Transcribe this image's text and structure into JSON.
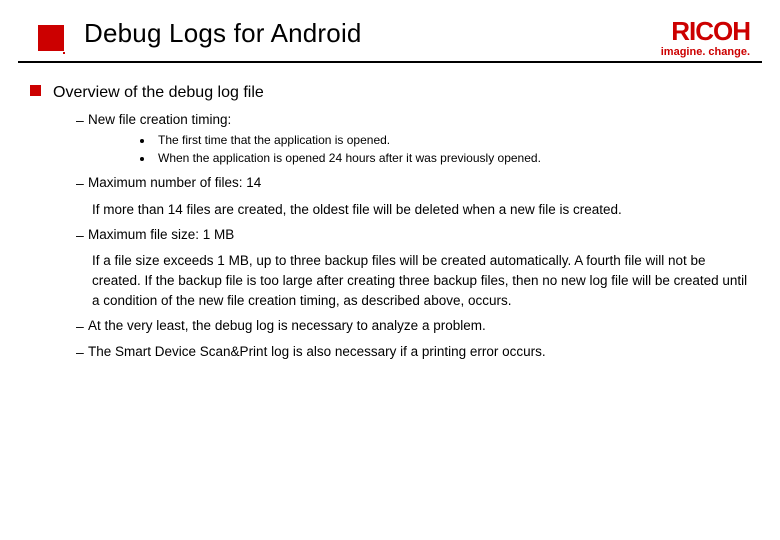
{
  "brand": {
    "name": "RICOH",
    "tagline": "imagine. change."
  },
  "title": "Debug Logs for Android",
  "section": {
    "heading": "Overview of the debug log file",
    "items": {
      "timing": {
        "label": "New file creation timing:",
        "bullets": {
          "b1": "The first time that the application is opened.",
          "b2": "When the application is opened 24 hours after it was previously opened."
        }
      },
      "maxfiles": {
        "label": "Maximum number of files: 14",
        "note": "If more than 14 files are created, the oldest file will be deleted when a new file is created."
      },
      "maxsize": {
        "label": "Maximum file size: 1 MB",
        "note": "If a file size exceeds 1 MB, up to three backup files will be created automatically. A fourth file will not be created. If the backup file is too large after creating three backup files, then no new log file will be created until a condition of the new file creation timing, as described above, occurs."
      },
      "atleast": "At the very least, the debug log is necessary to analyze a problem.",
      "scanprint": "The Smart Device Scan&Print log is also necessary if a printing error occurs."
    }
  }
}
